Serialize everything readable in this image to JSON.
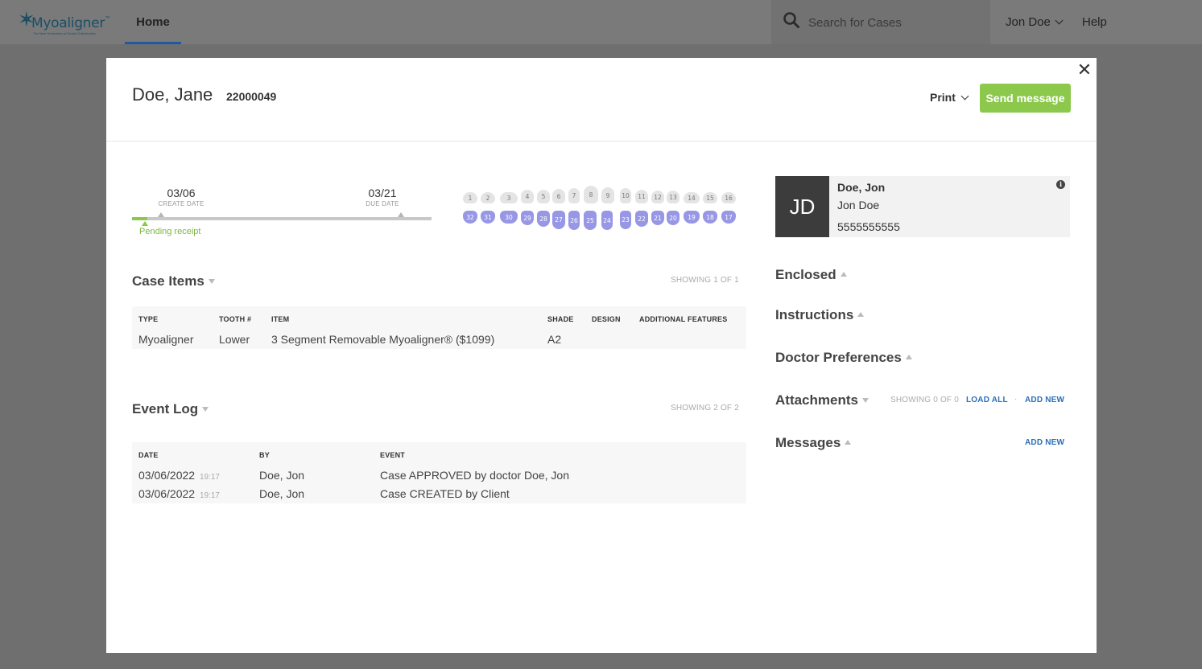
{
  "nav": {
    "logo_text": "Myoaligner",
    "logo_tm": "™",
    "logo_tagline": "The New Generation of Dental Orthodontics",
    "home_label": "Home",
    "search_placeholder": "Search for Cases",
    "user_label": "Jon Doe",
    "help_label": "Help"
  },
  "modal": {
    "close_glyph": "✕",
    "patient_name": "Doe, Jane",
    "case_number": "22000049",
    "print_label": "Print",
    "send_message_label": "Send message"
  },
  "timeline": {
    "create_date": "03/06",
    "create_label": "CREATE DATE",
    "due_date": "03/21",
    "due_label": "DUE DATE",
    "status": "Pending receipt",
    "progress_fraction": 0.05
  },
  "teeth": {
    "upper": [
      "1",
      "2",
      "3",
      "4",
      "5",
      "6",
      "7",
      "8",
      "9",
      "10",
      "11",
      "12",
      "13",
      "14",
      "15",
      "16"
    ],
    "lower": [
      "32",
      "31",
      "30",
      "29",
      "28",
      "27",
      "26",
      "25",
      "24",
      "23",
      "22",
      "21",
      "20",
      "19",
      "18",
      "17"
    ],
    "selected_arch": "lower"
  },
  "case_items": {
    "title": "Case Items",
    "showing": "SHOWING 1 OF 1",
    "headers": [
      "TYPE",
      "TOOTH #",
      "ITEM",
      "SHADE",
      "DESIGN",
      "ADDITIONAL FEATURES"
    ],
    "rows": [
      [
        "Myoaligner",
        "Lower",
        "3 Segment Removable Myoaligner® ($1099)",
        "A2",
        "",
        ""
      ]
    ]
  },
  "event_log": {
    "title": "Event Log",
    "showing": "SHOWING 2 OF 2",
    "headers": [
      "DATE",
      "BY",
      "EVENT"
    ],
    "rows": [
      {
        "date": "03/06/2022",
        "time": "19:17",
        "by": "Doe, Jon",
        "event": "Case APPROVED by doctor Doe, Jon"
      },
      {
        "date": "03/06/2022",
        "time": "19:17",
        "by": "Doe, Jon",
        "event": "Case CREATED by Client"
      }
    ]
  },
  "doctor": {
    "initials": "JD",
    "name": "Doe, Jon",
    "subname": "Jon Doe",
    "phone": "5555555555",
    "info_glyph": "i"
  },
  "side_sections": {
    "enclosed": "Enclosed",
    "instructions": "Instructions",
    "doctor_preferences": "Doctor Preferences",
    "attachments": "Attachments",
    "attachments_showing": "SHOWING 0 OF 0",
    "load_all": "LOAD ALL",
    "separator": "·",
    "add_new": "ADD NEW",
    "messages": "Messages",
    "messages_add_new": "ADD NEW"
  },
  "colors": {
    "accent_green": "#8cc84b",
    "link_blue": "#2a6fba",
    "tooth_lower": "#9797e6",
    "tooth_upper": "#e4e4e4",
    "avatar_bg": "#3c3c3c"
  }
}
